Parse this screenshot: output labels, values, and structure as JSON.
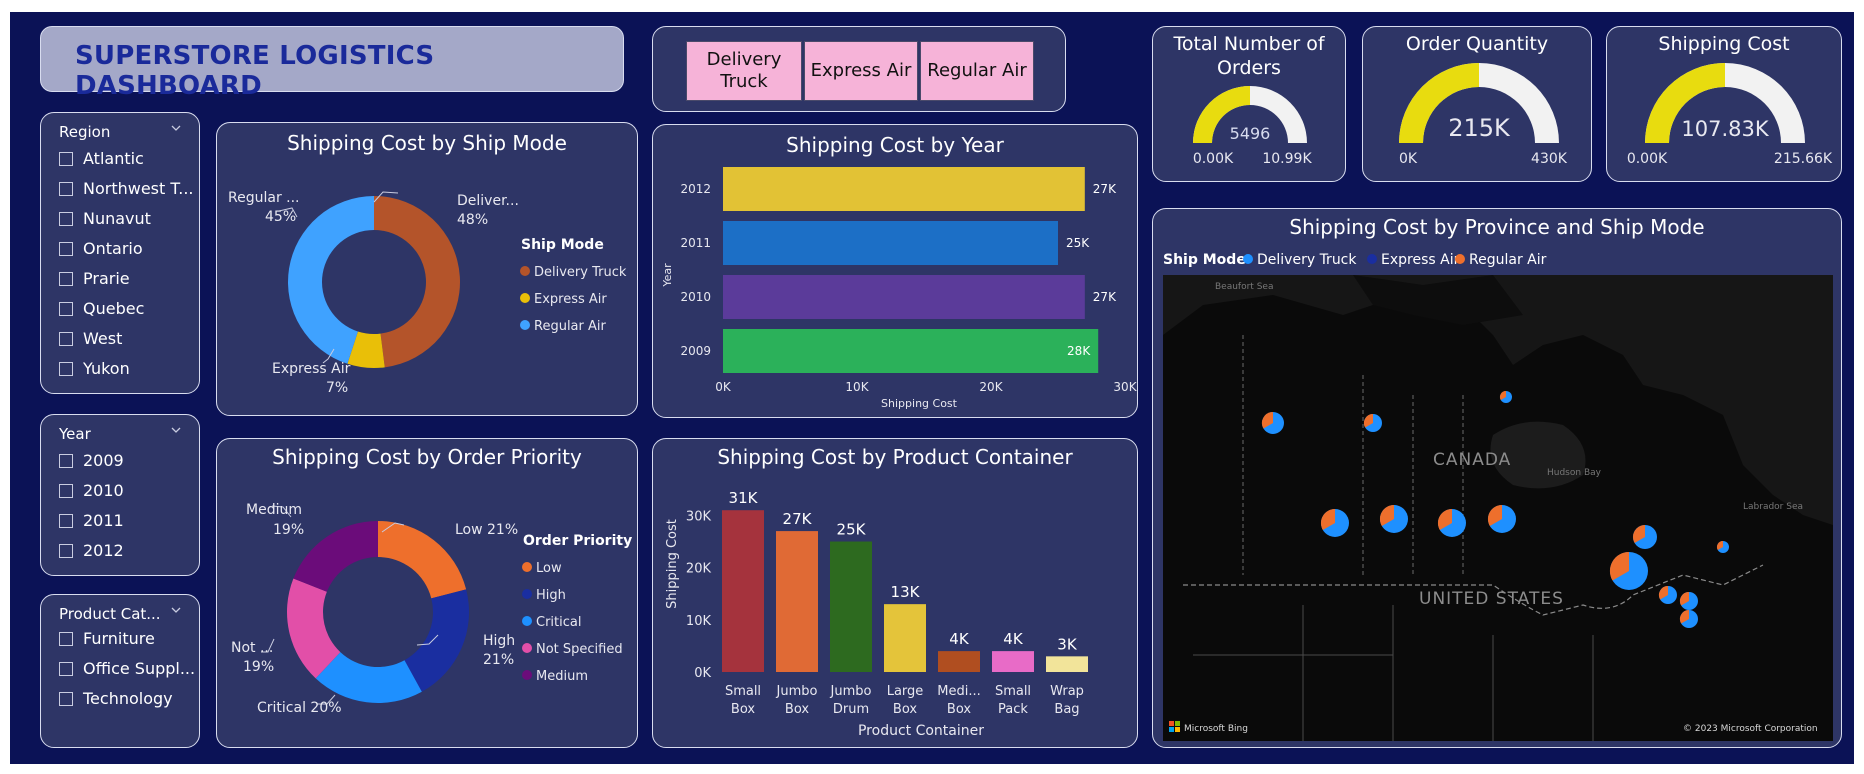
{
  "header": {
    "title": "SUPERSTORE LOGISTICS DASHBOARD"
  },
  "ship_buttons": [
    "Delivery Truck",
    "Express Air",
    "Regular Air"
  ],
  "slicers": {
    "region": {
      "label": "Region",
      "options": [
        "Atlantic",
        "Northwest T...",
        "Nunavut",
        "Ontario",
        "Prarie",
        "Quebec",
        "West",
        "Yukon"
      ]
    },
    "year": {
      "label": "Year",
      "options": [
        "2009",
        "2010",
        "2011",
        "2012"
      ]
    },
    "product_category": {
      "label": "Product Cat...",
      "options": [
        "Furniture",
        "Office Suppl...",
        "Technology"
      ]
    }
  },
  "kpis": {
    "orders": {
      "title_line1": "Total Number of",
      "title_line2": "Orders",
      "value": "5496",
      "min": "0.00K",
      "max": "10.99K",
      "fill": 0.5
    },
    "quantity": {
      "title": "Order Quantity",
      "value": "215K",
      "min": "0K",
      "max": "430K",
      "fill": 0.5
    },
    "shipping": {
      "title": "Shipping Cost",
      "value": "107.83K",
      "min": "0.00K",
      "max": "215.66K",
      "fill": 0.5
    }
  },
  "colors": {
    "background": "#0b1256",
    "card": "#2e3566",
    "gauge_fill": "#e8dc0f",
    "gauge_rest": "#f2f2f2"
  },
  "charts": {
    "ship_mode": {
      "title": "Shipping Cost by Ship Mode",
      "legend_title": "Ship Mode",
      "chart_data": {
        "type": "pie",
        "categories": [
          "Delivery Truck",
          "Express Air",
          "Regular Air"
        ],
        "values": [
          48,
          7,
          45
        ],
        "labels": [
          "Deliver...",
          "Express Air",
          "Regular ..."
        ],
        "percent_labels": [
          "48%",
          "7%",
          "45%"
        ],
        "colors": [
          "#b4542a",
          "#e9bf08",
          "#3fa2ff"
        ]
      }
    },
    "year": {
      "title": "Shipping Cost by Year",
      "chart_data": {
        "type": "bar",
        "orientation": "horizontal",
        "categories": [
          "2012",
          "2011",
          "2010",
          "2009"
        ],
        "values": [
          27,
          25,
          27,
          28
        ],
        "data_labels": [
          "27K",
          "25K",
          "27K",
          "28K"
        ],
        "colors": [
          "#e2c235",
          "#1c6fc6",
          "#5b3b9a",
          "#2bb15a"
        ],
        "xlabel": "Shipping Cost",
        "ylabel": "Year",
        "xticks": [
          "0K",
          "10K",
          "20K",
          "30K"
        ],
        "xlim": [
          0,
          30
        ]
      }
    },
    "priority": {
      "title": "Shipping Cost by Order Priority",
      "legend_title": "Order Priority",
      "chart_data": {
        "type": "pie",
        "categories": [
          "Low",
          "High",
          "Critical",
          "Not Specified",
          "Medium"
        ],
        "values": [
          21,
          21,
          20,
          19,
          19
        ],
        "labels": [
          "Low 21%",
          "High",
          "Critical 20%",
          "Not ...",
          "Medium"
        ],
        "percent_labels": [
          "",
          "21%",
          "",
          "19%",
          "19%"
        ],
        "colors": [
          "#ee6f2c",
          "#1a2ea0",
          "#1e90ff",
          "#e24fa8",
          "#6b0c7a"
        ]
      }
    },
    "container": {
      "title": "Shipping Cost by Product Container",
      "chart_data": {
        "type": "bar",
        "categories": [
          "Small Box",
          "Jumbo Box",
          "Jumbo Drum",
          "Large Box",
          "Medi... Box",
          "Small Pack",
          "Wrap Bag"
        ],
        "category_lines": [
          [
            "Small",
            "Box"
          ],
          [
            "Jumbo",
            "Box"
          ],
          [
            "Jumbo",
            "Drum"
          ],
          [
            "Large",
            "Box"
          ],
          [
            "Medi...",
            "Box"
          ],
          [
            "Small",
            "Pack"
          ],
          [
            "Wrap",
            "Bag"
          ]
        ],
        "values": [
          31,
          27,
          25,
          13,
          4,
          4,
          3
        ],
        "data_labels": [
          "31K",
          "27K",
          "25K",
          "13K",
          "4K",
          "4K",
          "3K"
        ],
        "colors": [
          "#a5333d",
          "#e06a35",
          "#2d6a1f",
          "#e4c43a",
          "#b04e20",
          "#e86bc7",
          "#f2e49a"
        ],
        "xlabel": "Product Container",
        "ylabel": "Shipping Cost",
        "yticks": [
          "0K",
          "10K",
          "20K",
          "30K"
        ],
        "ylim": [
          0,
          32
        ]
      }
    },
    "map": {
      "title": "Shipping Cost by Province and Ship Mode",
      "legend_title": "Ship Mode",
      "legend": [
        {
          "name": "Delivery Truck",
          "color": "#1e90ff"
        },
        {
          "name": "Express Air",
          "color": "#1a2ea0"
        },
        {
          "name": "Regular Air",
          "color": "#ee6f2c"
        }
      ],
      "labels": {
        "canada": "CANADA",
        "usa": "UNITED STATES",
        "beaufort": "Beaufort Sea",
        "hudson": "Hudson Bay",
        "labrador": "Labrador Sea"
      },
      "attribution": "© 2023 Microsoft Corporation",
      "bing": "Microsoft Bing"
    }
  }
}
